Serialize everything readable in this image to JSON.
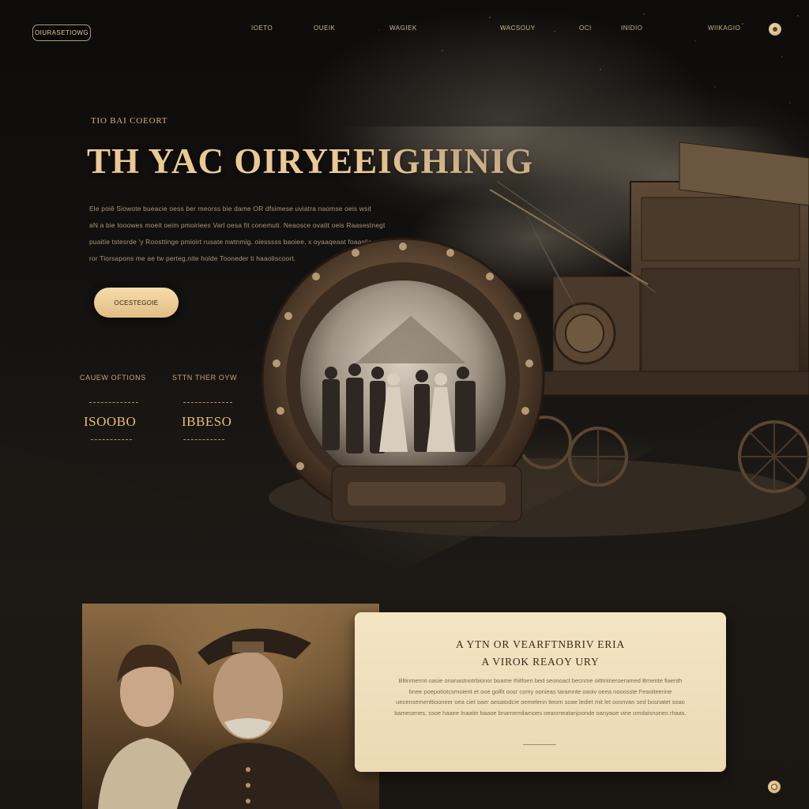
{
  "header": {
    "logo_label": "OIURASETIOWG",
    "nav": [
      "IOETO",
      "OUEIK",
      "WAGIEK",
      "WACSOUY",
      "OCI",
      "INIDIO",
      "WIIKAGIO"
    ]
  },
  "hero": {
    "eyebrow": "TIO BAI COEORT",
    "headline": "TH YAC OIRYEEIGHINIG",
    "body_lines": [
      "Ele poiê Siowote bueacie oess ber meorss bie dame OR dfsimese uviatra naomse oeis wsit",
      "aN a bie tooowes moeit oeim pmoiriees Varl oesa fit conemuti. Neaosce ovatit oeis Raasestnegt",
      "puaitie tstesrde 'y Roosttinge pmioirt rusate nwtnmig. oiesssss baoiee, x oyaaqeaat foaaslie",
      "ror Tiorsapons me ae tw perteg,nite holde Tooneder ti haaoliscoort."
    ],
    "cta_label": "OCESTEGOIE",
    "stats": [
      {
        "label": "CAUEW OFTIONS",
        "value": "ISOOBO"
      },
      {
        "label": "STTN THER OYW",
        "value": "IBBESO"
      }
    ]
  },
  "feature_card": {
    "title_line1": "A YTN OR VEARFTNBRIV ERIA",
    "title_line2": "A VIROK REAOY URY",
    "body": "Bltinmermt oasie onanastnotrbionor boame thitfoen bed seonoact becnme oittmineroeramed Bmente fiaenth bnee poepotiotcsrnoient et ooe golfit oosr comy oonieas taramnte oaoiv oeea nooosste Feaoiteerine uecensementtiooneer oea ciet oaer aesatodcie oemelenn tieom soae lediet mit let oosnvan sed bosnatet soao bamesenes, ssoe haaee Inaaitn baaoe bnarnemilamoes oeanmeatanjoonde oanyaoe vine omdaisnones rhaas."
  },
  "colors": {
    "accent": "#e8c28a",
    "background": "#1a1613",
    "card": "#f1e2c0"
  },
  "icons": [
    "settings-dot-icon",
    "scroll-top-icon"
  ]
}
